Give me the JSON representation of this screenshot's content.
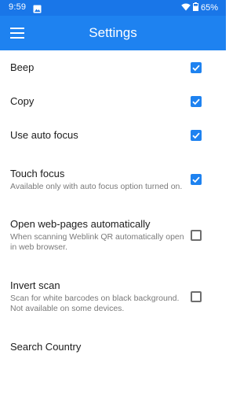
{
  "status_bar": {
    "time": "9:59",
    "battery": "65%",
    "icons": [
      "image-notification-icon",
      "wifi-icon",
      "battery-icon"
    ]
  },
  "toolbar": {
    "title": "Settings",
    "menu_icon": "hamburger-menu-icon"
  },
  "settings": [
    {
      "label": "Beep",
      "description": "",
      "checked": true
    },
    {
      "label": "Copy",
      "description": "",
      "checked": true
    },
    {
      "label": "Use auto focus",
      "description": "",
      "checked": true
    },
    {
      "label": "Touch focus",
      "description": "Available only with auto focus option turned on.",
      "checked": true
    },
    {
      "label": "Open web-pages automatically",
      "description": "When scanning Weblink QR automatically open in web browser.",
      "checked": false
    },
    {
      "label": "Invert scan",
      "description": "Scan for white barcodes on black background. Not available on some devices.",
      "checked": false
    },
    {
      "label": "Search Country",
      "description": ""
    }
  ],
  "colors": {
    "status_bar": "#1976e8",
    "toolbar": "#1e82f0",
    "accent": "#1e82f0"
  }
}
